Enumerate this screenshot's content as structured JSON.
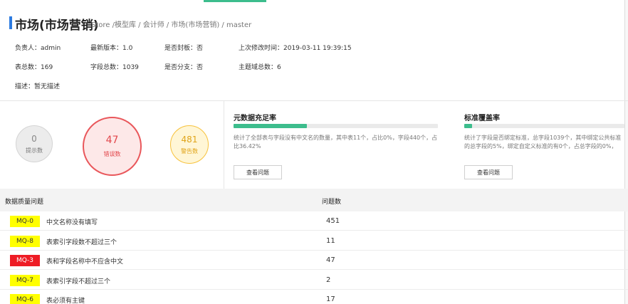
{
  "header": {
    "title": "市场(市场营销)",
    "breadcrumb": "Store /模型库 / 会计师 / 市场(市场营销) / master"
  },
  "info": {
    "owner": "负责人：admin",
    "latest_version": "最新版本：1.0",
    "sealed": "是否封板：否",
    "last_modified": "上次修改时间：2019-03-11 19:39:15",
    "table_count": "表总数：169",
    "field_count": "字段总数：1039",
    "branched": "是否分支：否",
    "topic_count": "主题域总数：6",
    "description": "描述：暂无描述"
  },
  "summary": {
    "hint": {
      "count": "0",
      "label": "提示数"
    },
    "error": {
      "count": "47",
      "label": "错误数"
    },
    "warning": {
      "count": "481",
      "label": "警告数"
    }
  },
  "metrics": [
    {
      "title": "元数据充足率",
      "progress": 0.36,
      "description": "统计了全部表与字段没有中文名的数量，其中表11个，占比0%，字段440个，占比36.42%",
      "button": "查看问题"
    },
    {
      "title": "标准覆盖率",
      "progress": 0.05,
      "description": "统计了字段是否绑定标准，总字段1039个，其中绑定公共标准的总字段的5%，绑定自定义标准的有0个，占总字段的0%，",
      "button": "查看问题"
    }
  ],
  "table": {
    "headers": [
      "数据质量问题",
      "问题数"
    ],
    "rows": [
      {
        "code": "MQ-0",
        "description": "中文名称没有填写",
        "count": "451",
        "level": "warning"
      },
      {
        "code": "MQ-8",
        "description": "表索引字段数不超过三个",
        "count": "11",
        "level": "warning"
      },
      {
        "code": "MQ-3",
        "description": "表和字段名称中不应含中文",
        "count": "47",
        "level": "error"
      },
      {
        "code": "MQ-7",
        "description": "表索引字段不超过三个",
        "count": "2",
        "level": "warning"
      },
      {
        "code": "MQ-6",
        "description": "表必须有主键",
        "count": "17",
        "level": "warning"
      }
    ]
  },
  "colors": {
    "accent": "#3dbd8d",
    "title_marker": "#2d7be0",
    "badge_warning": "#ffff00",
    "badge_error": "#ee1c25"
  }
}
